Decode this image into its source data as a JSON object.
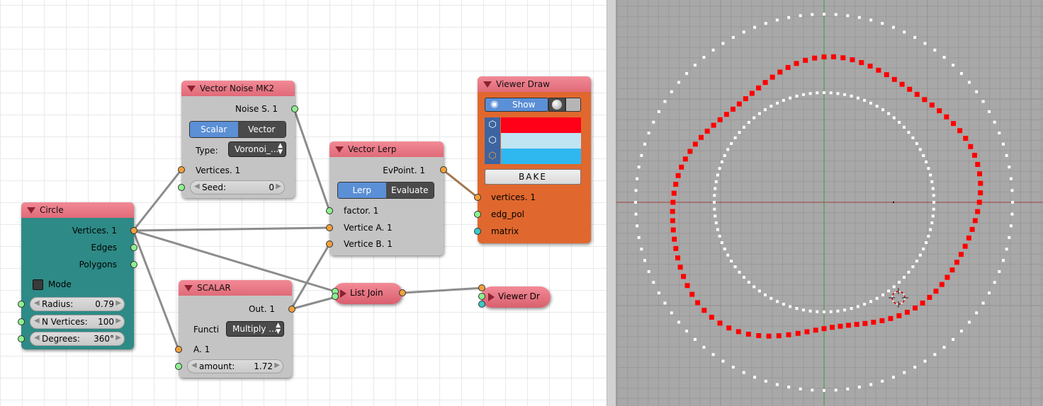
{
  "nodes": {
    "circle": {
      "title": "Circle",
      "outputs": [
        "Vertices. 1",
        "Edges",
        "Polygons"
      ],
      "mode_label": "Mode",
      "radius": {
        "label": "Radius:",
        "value": "0.79"
      },
      "nverts": {
        "label": "N Vertices:",
        "value": "100"
      },
      "degrees": {
        "label": "Degrees:",
        "value": "360°"
      }
    },
    "noise": {
      "title": "Vector Noise MK2",
      "output": "Noise S. 1",
      "modes": [
        "Scalar",
        "Vector"
      ],
      "type_label": "Type:",
      "type_value": "Voronoi_...",
      "input_vertices": "Vertices. 1",
      "seed": {
        "label": "Seed:",
        "value": "0"
      }
    },
    "lerp": {
      "title": "Vector Lerp",
      "output": "EvPoint. 1",
      "modes": [
        "Lerp",
        "Evaluate"
      ],
      "inputs": [
        "factor. 1",
        "Vertice A. 1",
        "Vertice B. 1"
      ]
    },
    "scalar": {
      "title": "SCALAR",
      "output": "Out. 1",
      "func_label": "Functi",
      "func_value": "Multiply ...",
      "input_a": "A. 1",
      "amount": {
        "label": "amount:",
        "value": "1.72"
      }
    },
    "viewer": {
      "title": "Viewer Draw",
      "show_label": "Show",
      "colors": [
        "#ff0018",
        "#bfe4f2",
        "#2fb7f0"
      ],
      "bake_label": "BAKE",
      "inputs": [
        "vertices. 1",
        "edg_pol",
        "matrix"
      ],
      "bg_color": "#e0682e"
    },
    "listjoin": {
      "title": "List Join"
    },
    "viewer2": {
      "title": "Viewer Dr"
    }
  },
  "icons": {
    "eye": "eye-icon",
    "sphere": "sphere-icon",
    "cube": "cube-icon",
    "collapse": "collapse-triangle-icon"
  },
  "viewport": {
    "background": "#a8a8a8",
    "point_clouds": [
      {
        "color": "#ffffff",
        "radius": 0.79,
        "points": 100
      },
      {
        "color": "#ffffff",
        "radius": 1.36,
        "points": 100
      },
      {
        "color": "#ff0000",
        "radius": "noisy",
        "points": 100
      }
    ]
  }
}
